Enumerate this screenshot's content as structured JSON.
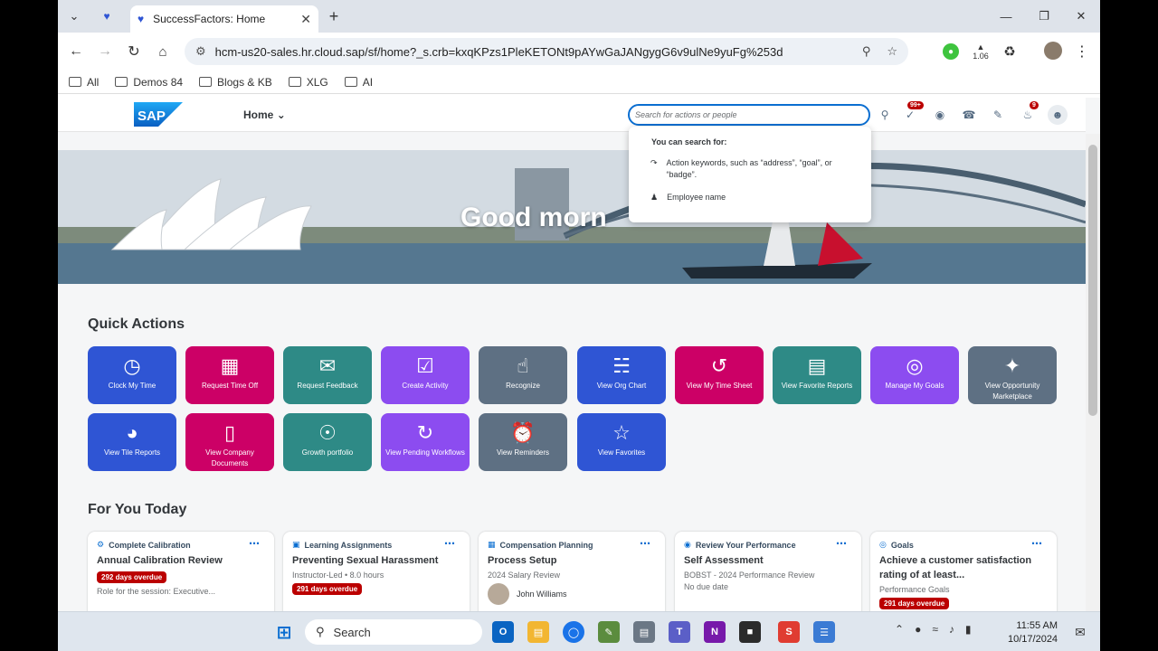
{
  "browser": {
    "tab_title": "SuccessFactors: Home",
    "url": "hcm-us20-sales.hr.cloud.sap/sf/home?_s.crb=kxqKPzs1PleKETONt9pAYwGaJANgygG6v9ulNe9yuFg%253d",
    "extension_badge": "1.06",
    "bookmarks": [
      "All",
      "Demos 84",
      "Blogs & KB",
      "XLG",
      "AI"
    ]
  },
  "header": {
    "logo_text": "SAP",
    "home_label": "Home",
    "search_placeholder": "Search for actions or people",
    "todo_badge": "99+",
    "notif_badge": "9"
  },
  "search_popup": {
    "title": "You can search for:",
    "items": [
      {
        "icon": "arrow-redo-icon",
        "text": "Action keywords, such as “address”, “goal”, or “badge”."
      },
      {
        "icon": "person-icon",
        "text": "Employee name"
      }
    ]
  },
  "hero": {
    "greeting": "Good morn"
  },
  "quick_actions": {
    "title": "Quick Actions",
    "items": [
      {
        "label": "Clock My Time",
        "color": "#2f55d4",
        "icon": "clock-plus-icon"
      },
      {
        "label": "Request Time Off",
        "color": "#cc0066",
        "icon": "calendar-icon"
      },
      {
        "label": "Request Feedback",
        "color": "#2e8a86",
        "icon": "feedback-icon"
      },
      {
        "label": "Create Activity",
        "color": "#8c4cf0",
        "icon": "clipboard-check-icon"
      },
      {
        "label": "Recognize",
        "color": "#5e7083",
        "icon": "thumbs-up-icon"
      },
      {
        "label": "View Org Chart",
        "color": "#2f55d4",
        "icon": "org-chart-icon"
      },
      {
        "label": "View My Time Sheet",
        "color": "#cc0066",
        "icon": "history-icon"
      },
      {
        "label": "View Favorite Reports",
        "color": "#2e8a86",
        "icon": "reports-icon"
      },
      {
        "label": "Manage My Goals",
        "color": "#8c4cf0",
        "icon": "target-icon"
      },
      {
        "label": "View Opportunity Marketplace",
        "color": "#5e7083",
        "icon": "growth-star-icon"
      },
      {
        "label": "View Tile Reports",
        "color": "#2f55d4",
        "icon": "pie-icon"
      },
      {
        "label": "View Company Documents",
        "color": "#cc0066",
        "icon": "document-icon"
      },
      {
        "label": "Growth portfolio",
        "color": "#2e8a86",
        "icon": "eye-icon"
      },
      {
        "label": "View Pending Workflows",
        "color": "#8c4cf0",
        "icon": "workflow-icon"
      },
      {
        "label": "View Reminders",
        "color": "#5e7083",
        "icon": "reminder-icon"
      },
      {
        "label": "View Favorites",
        "color": "#2f55d4",
        "icon": "star-icon"
      }
    ]
  },
  "for_you": {
    "title": "For You Today",
    "cards": [
      {
        "category": "Complete Calibration",
        "title": "Annual Calibration Review",
        "badge": "292 days overdue",
        "sub": "Role for the session: Executive..."
      },
      {
        "category": "Learning Assignments",
        "title": "Preventing Sexual Harassment",
        "sub": "Instructor-Led • 8.0 hours",
        "badge": "291 days overdue"
      },
      {
        "category": "Compensation Planning",
        "title": "Process Setup",
        "sub": "2024 Salary Review",
        "person": "John Williams"
      },
      {
        "category": "Review Your Performance",
        "title": "Self Assessment",
        "sub": "BOBST - 2024 Performance Review",
        "sub2": "No due date"
      },
      {
        "category": "Goals",
        "title": "Achieve a customer satisfaction rating of at least...",
        "sub": "Performance Goals",
        "badge": "291 days overdue"
      }
    ]
  },
  "taskbar": {
    "search_label": "Search",
    "time": "11:55 AM",
    "date": "10/17/2024"
  }
}
